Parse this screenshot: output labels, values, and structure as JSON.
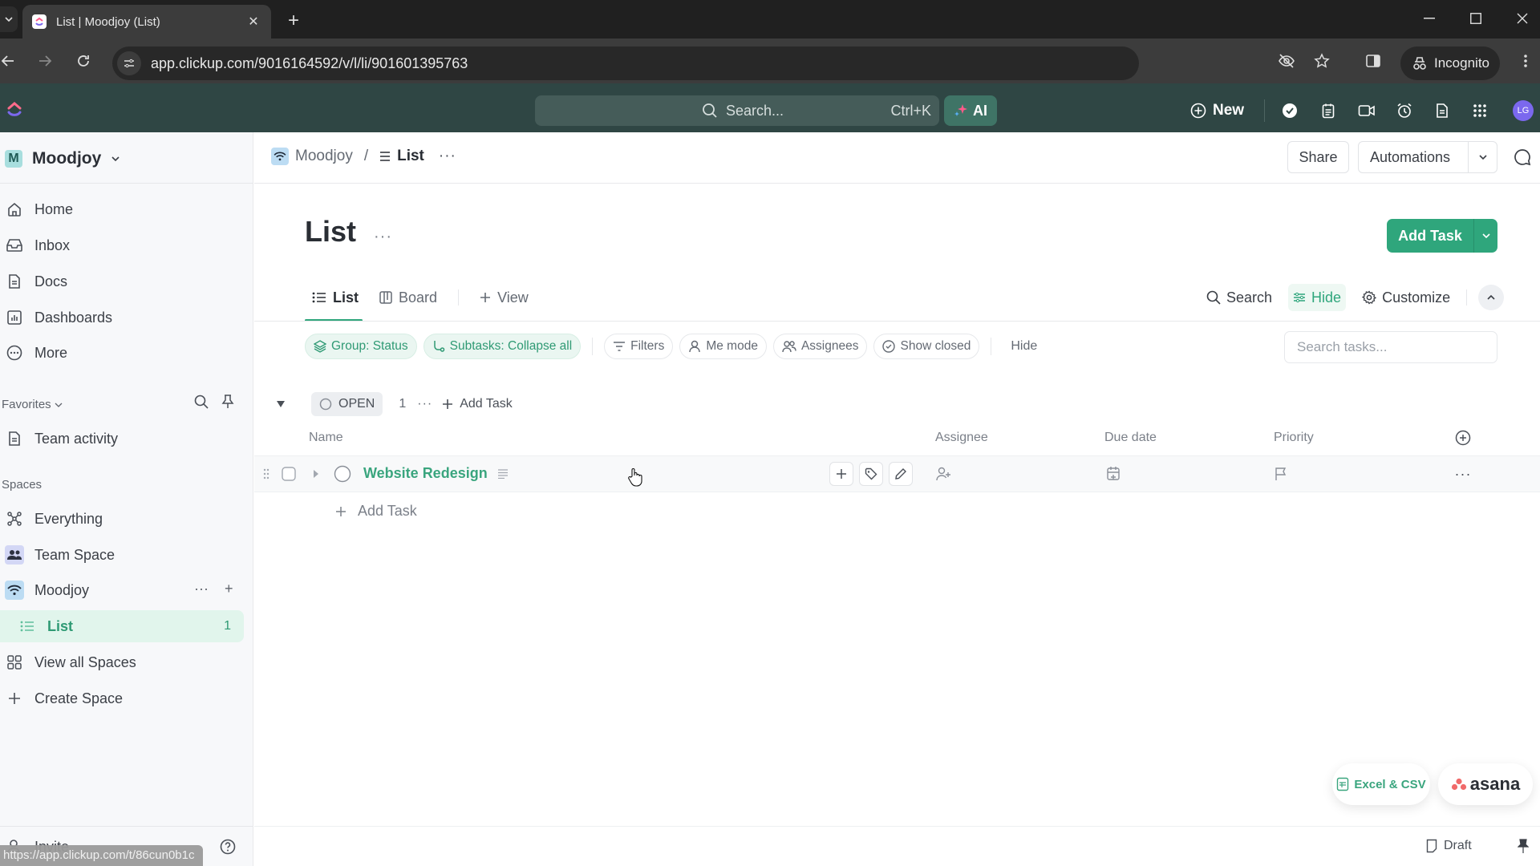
{
  "browser": {
    "tab_title": "List | Moodjoy (List)",
    "url": "app.clickup.com/9016164592/v/l/li/901601395763",
    "incognito_label": "Incognito",
    "status_url": "https://app.clickup.com/t/86cun0b1c"
  },
  "app_header": {
    "search_placeholder": "Search...",
    "search_shortcut": "Ctrl+K",
    "ai_label": "AI",
    "new_label": "New",
    "avatar_initials": "LG",
    "icons": [
      "check-circle-icon",
      "notepad-icon",
      "video-icon",
      "alarm-icon",
      "doc-icon",
      "apps-grid-icon"
    ]
  },
  "sidebar": {
    "workspace": {
      "initial": "M",
      "name": "Moodjoy"
    },
    "nav": [
      {
        "label": "Home",
        "icon": "home-icon"
      },
      {
        "label": "Inbox",
        "icon": "inbox-icon"
      },
      {
        "label": "Docs",
        "icon": "doc-icon"
      },
      {
        "label": "Dashboards",
        "icon": "dashboard-icon"
      },
      {
        "label": "More",
        "icon": "more-circle-icon"
      }
    ],
    "favorites_label": "Favorites",
    "favorites": [
      {
        "label": "Team activity",
        "icon": "doc-icon"
      }
    ],
    "spaces_label": "Spaces",
    "spaces": [
      {
        "label": "Everything",
        "icon": "everything-icon"
      },
      {
        "label": "Team Space",
        "icon": "team-icon"
      },
      {
        "label": "Moodjoy",
        "icon": "wifi-icon"
      }
    ],
    "active_list": {
      "label": "List",
      "count": "1"
    },
    "view_all_spaces": "View all Spaces",
    "create_space": "Create Space",
    "invite": "Invite"
  },
  "breadcrumb": {
    "space": "Moodjoy",
    "separator": "/",
    "current": "List"
  },
  "top_actions": {
    "share": "Share",
    "automations": "Automations"
  },
  "page": {
    "title": "List",
    "add_task": "Add Task"
  },
  "view_tabs": [
    {
      "label": "List",
      "active": true
    },
    {
      "label": "Board",
      "active": false
    },
    {
      "label": "View",
      "active": false
    }
  ],
  "view_tools": {
    "search": "Search",
    "hide": "Hide",
    "customize": "Customize"
  },
  "filters": {
    "group": "Group: Status",
    "subtasks": "Subtasks: Collapse all",
    "filters": "Filters",
    "me_mode": "Me mode",
    "assignees": "Assignees",
    "show_closed": "Show closed",
    "hide": "Hide",
    "search_placeholder": "Search tasks..."
  },
  "group": {
    "status": "OPEN",
    "count": "1",
    "add_task": "Add Task"
  },
  "columns": {
    "name": "Name",
    "assignee": "Assignee",
    "due_date": "Due date",
    "priority": "Priority"
  },
  "tasks": [
    {
      "name": "Website Redesign",
      "assignee": "",
      "due_date": "",
      "priority": ""
    }
  ],
  "inline_add_task": "Add Task",
  "import": {
    "excel": "Excel & CSV",
    "asana": "asana"
  },
  "footer": {
    "draft": "Draft"
  },
  "colors": {
    "accent": "#2fa67c",
    "app_header": "#2f4644",
    "avatar": "#7b68ee"
  }
}
